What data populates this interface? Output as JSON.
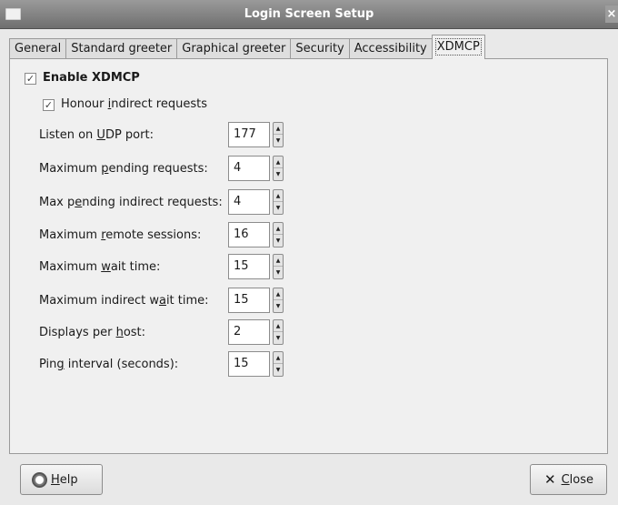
{
  "window": {
    "title": "Login Screen Setup"
  },
  "tabs": [
    {
      "label": "General"
    },
    {
      "label": "Standard greeter"
    },
    {
      "label": "Graphical greeter"
    },
    {
      "label": "Security"
    },
    {
      "label": "Accessibility"
    },
    {
      "label": "XDMCP",
      "active": true
    }
  ],
  "enable_xdmcp": {
    "label": "Enable XDMCP",
    "checked": true
  },
  "honour_indirect": {
    "label_pre": "Honour ",
    "label_u": "i",
    "label_post": "ndirect requests",
    "checked": true
  },
  "fields": [
    {
      "pre": "Listen on ",
      "u": "U",
      "post": "DP port:",
      "value": "177"
    },
    {
      "pre": "Maximum ",
      "u": "p",
      "post": "ending requests:",
      "value": "4"
    },
    {
      "pre": "Max p",
      "u": "e",
      "post": "nding indirect requests:",
      "value": "4"
    },
    {
      "pre": "Maximum ",
      "u": "r",
      "post": "emote sessions:",
      "value": "16"
    },
    {
      "pre": "Maximum ",
      "u": "w",
      "post": "ait time:",
      "value": "15"
    },
    {
      "pre": "Maximum indirect w",
      "u": "a",
      "post": "it time:",
      "value": "15"
    },
    {
      "pre": "Displays per ",
      "u": "h",
      "post": "ost:",
      "value": "2"
    },
    {
      "pre": "Pin",
      "u": "g",
      "post": " interval (seconds):",
      "value": "15"
    }
  ],
  "buttons": {
    "help": {
      "u": "H",
      "rest": "elp"
    },
    "close": {
      "u": "C",
      "rest": "lose"
    }
  },
  "icons": {
    "help": "help-icon",
    "close": "close-icon",
    "menu": "window-menu-icon"
  }
}
